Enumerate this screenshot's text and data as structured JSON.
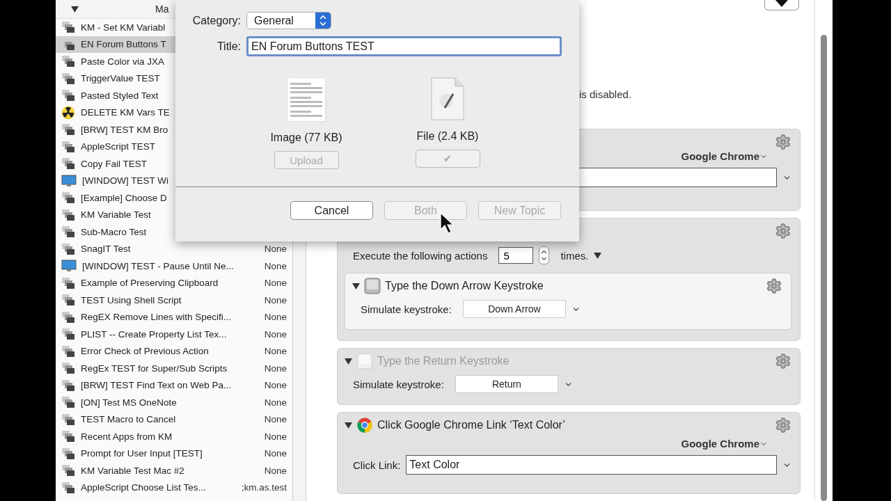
{
  "macro_list": {
    "header": {
      "column_1": "Ma"
    },
    "rows": [
      {
        "name": "KM - Set KM Variabl",
        "kind": "macro",
        "selected": false
      },
      {
        "name": "EN Forum Buttons T",
        "kind": "macro",
        "selected": true
      },
      {
        "name": "Paste Color via JXA",
        "kind": "macro",
        "selected": false
      },
      {
        "name": "TriggerValue TEST",
        "kind": "macro",
        "selected": false
      },
      {
        "name": "Pasted Styled Text",
        "kind": "macro",
        "selected": false
      },
      {
        "name": "DELETE KM Vars TE",
        "kind": "radiation",
        "selected": false
      },
      {
        "name": "[BRW] TEST KM Bro",
        "kind": "macro",
        "selected": false
      },
      {
        "name": "AppleScript TEST",
        "kind": "macro",
        "selected": false
      },
      {
        "name": "Copy Fail TEST",
        "kind": "macro",
        "selected": false
      },
      {
        "name": "[WINDOW] TEST Wi",
        "kind": "monitor",
        "selected": false
      },
      {
        "name": "[Example] Choose D",
        "kind": "macro",
        "selected": false
      },
      {
        "name": "KM Variable Test",
        "kind": "macro",
        "selected": false
      },
      {
        "name": "Sub-Macro Test",
        "kind": "macro",
        "selected": false
      },
      {
        "name": "SnagIT Test",
        "kind": "macro",
        "selected": false,
        "trigger": "None"
      },
      {
        "name": "[WINDOW] TEST - Pause Until Ne...",
        "kind": "monitor",
        "selected": false,
        "trigger": "None"
      },
      {
        "name": "Example of Preserving Clipboard",
        "kind": "macro",
        "selected": false,
        "trigger": "None"
      },
      {
        "name": "TEST Using Shell Script",
        "kind": "macro",
        "selected": false,
        "trigger": "None"
      },
      {
        "name": "RegEX Remove Lines with Specifi...",
        "kind": "macro",
        "selected": false,
        "trigger": "None"
      },
      {
        "name": "PLIST -- Create Property List Tex...",
        "kind": "macro",
        "selected": false,
        "trigger": "None"
      },
      {
        "name": "Error Check of Previous Action",
        "kind": "macro",
        "selected": false,
        "trigger": "None"
      },
      {
        "name": "RegEx TEST for Super/Sub Scripts",
        "kind": "macro",
        "selected": false,
        "trigger": "None"
      },
      {
        "name": "[BRW] TEST Find Text on Web Pa...",
        "kind": "macro",
        "selected": false,
        "trigger": "None"
      },
      {
        "name": "[ON] Test MS OneNote",
        "kind": "macro",
        "selected": false,
        "trigger": "None"
      },
      {
        "name": "TEST Macro to Cancel",
        "kind": "macro",
        "selected": false,
        "trigger": "None"
      },
      {
        "name": "Recent Apps from KM",
        "kind": "macro",
        "selected": false,
        "trigger": "None"
      },
      {
        "name": "Prompt for User Input [TEST]",
        "kind": "macro",
        "selected": false,
        "trigger": "None"
      },
      {
        "name": "KM Variable Test Mac #2",
        "kind": "macro",
        "selected": false,
        "trigger": "None"
      },
      {
        "name": "AppleScript Choose List Tes...",
        "kind": "macro",
        "selected": false,
        "trigger": ";km.as.test"
      }
    ]
  },
  "editor": {
    "note": "is disabled.",
    "actions": [
      {
        "kind": "app_field",
        "disabled": false,
        "app": "Google Chrome"
      },
      {
        "kind": "repeat",
        "disabled": false,
        "label": "Execute the following actions",
        "count": "5",
        "suffix": "times.",
        "children": [
          {
            "kind": "keystroke",
            "disabled": false,
            "title": "Type the Down Arrow Keystroke",
            "label": "Simulate keystroke:",
            "key": "Down Arrow"
          }
        ]
      },
      {
        "kind": "keystroke",
        "disabled": true,
        "title": "Type the Return Keystroke",
        "label": "Simulate keystroke:",
        "key": "Return"
      },
      {
        "kind": "click_link",
        "disabled": false,
        "title": "Click Google Chrome Link ‘Text Color’",
        "app": "Google Chrome",
        "label": "Click Link:",
        "value": "Text Color"
      }
    ]
  },
  "dialog": {
    "category_label": "Category:",
    "category": "General",
    "title_label": "Title:",
    "title_value": "EN Forum Buttons TEST",
    "attachments": [
      {
        "kind": "image",
        "label": "Image (77 KB)",
        "button": "Upload",
        "disabled": true
      },
      {
        "kind": "file",
        "label": "File (2.4 KB)",
        "button": "✔",
        "disabled": true
      }
    ],
    "buttons": [
      {
        "label": "Cancel",
        "disabled": false
      },
      {
        "label": "Both",
        "disabled": true
      },
      {
        "label": "New Topic",
        "disabled": true
      }
    ]
  }
}
